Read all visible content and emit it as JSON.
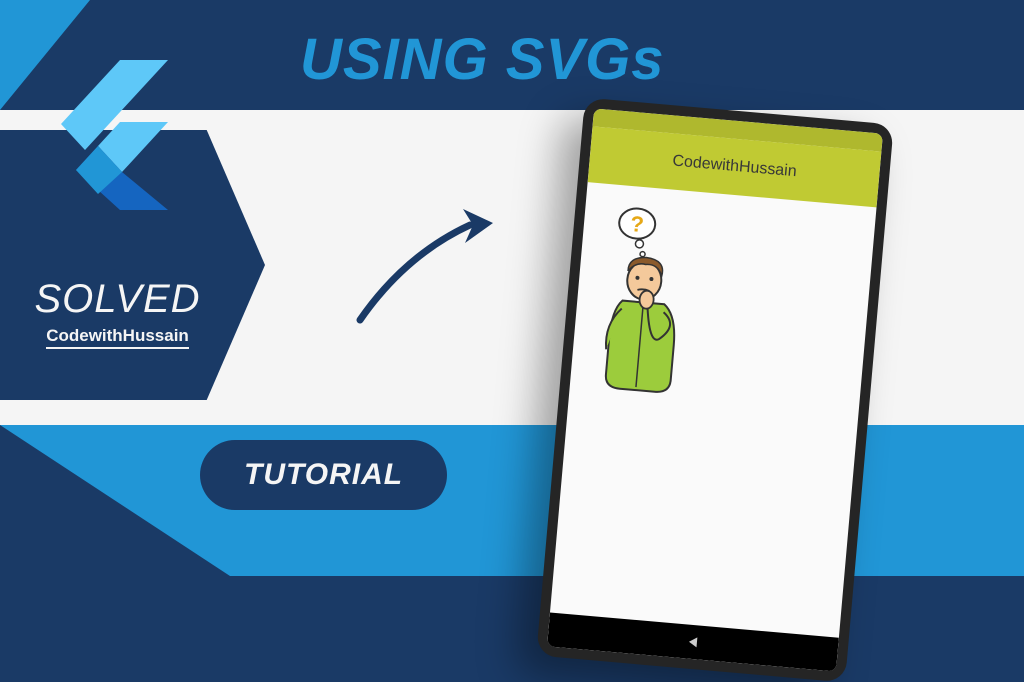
{
  "title": "USING SVGs",
  "badge": "SOLVED",
  "brand": "CodewithHussain",
  "pill": "TUTORIAL",
  "phone": {
    "appTitle": "CodewithHussain"
  },
  "colors": {
    "darkBlue": "#1a3a66",
    "lightBlue": "#2196d6",
    "offWhite": "#f5f5f5",
    "appBar": "#c0ca33"
  }
}
